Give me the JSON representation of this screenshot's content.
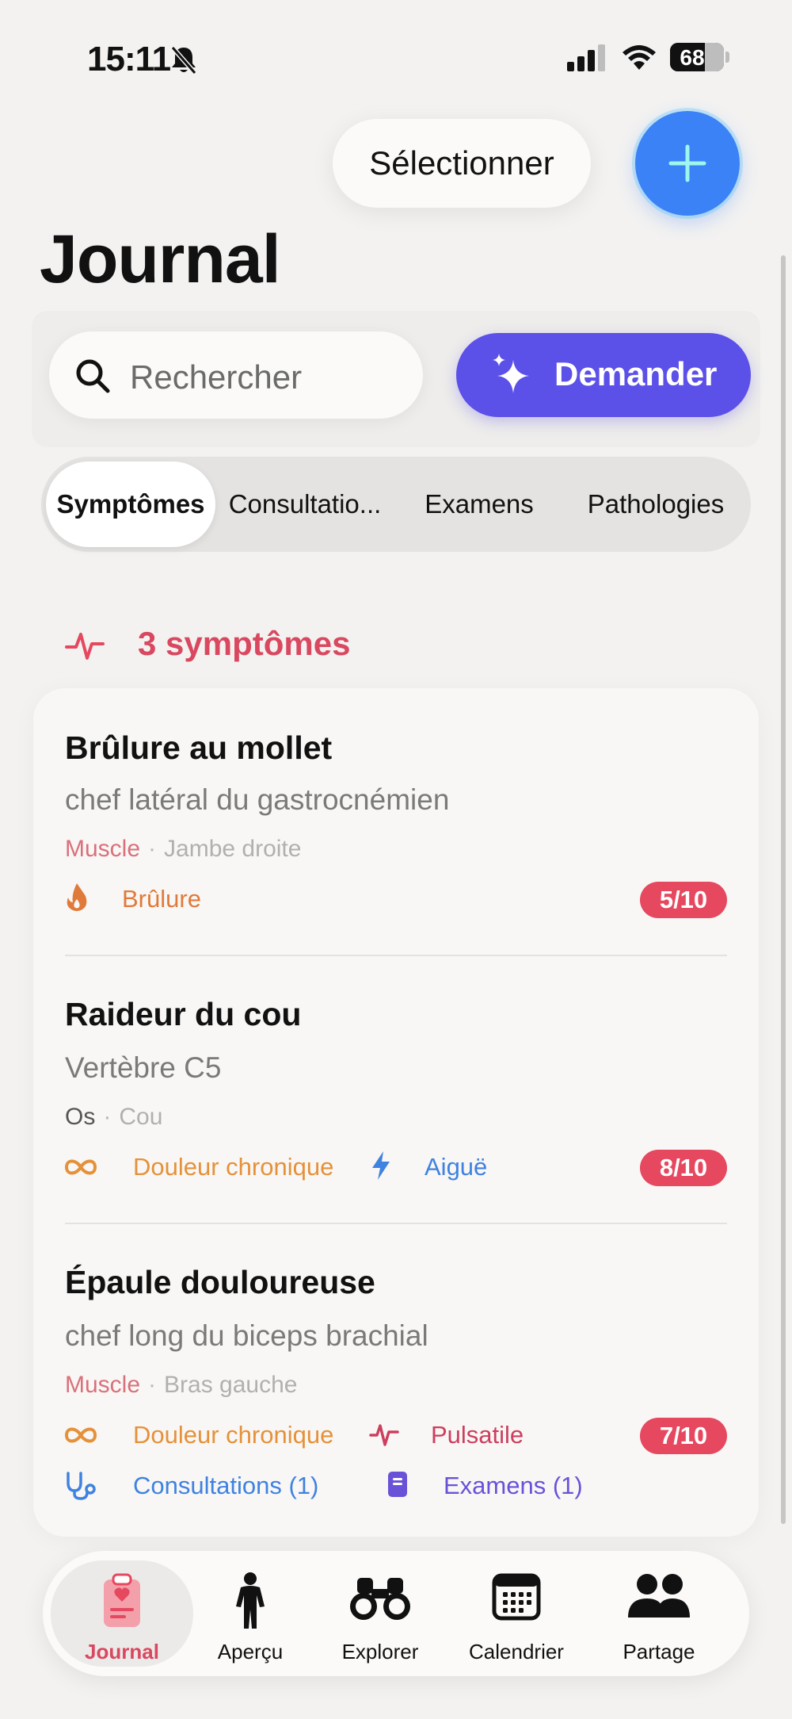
{
  "status_bar": {
    "time": "15:11",
    "battery": "68"
  },
  "header": {
    "select_label": "Sélectionner",
    "title": "Journal"
  },
  "search": {
    "placeholder": "Rechercher",
    "ask_label": "Demander"
  },
  "tabs": [
    {
      "label": "Symptômes",
      "active": true
    },
    {
      "label": "Consultatio..."
    },
    {
      "label": "Examens"
    },
    {
      "label": "Pathologies"
    }
  ],
  "section": {
    "title": "3 symptômes"
  },
  "symptoms": [
    {
      "title": "Brûlure au mollet",
      "subtitle": "chef latéral du gastrocnémien",
      "category": "Muscle",
      "location": "Jambe droite",
      "tags": [
        {
          "icon": "flame-icon",
          "label": "Brûlure",
          "color": "#e07a3a"
        }
      ],
      "score": "5/10"
    },
    {
      "title": "Raideur du cou",
      "subtitle": "Vertèbre C5",
      "category": "Os",
      "location": "Cou",
      "tags": [
        {
          "icon": "infinity-icon",
          "label": "Douleur chronique",
          "color": "#e5913a"
        },
        {
          "icon": "lightning-icon",
          "label": "Aiguë",
          "color": "#3f82e0"
        }
      ],
      "score": "8/10"
    },
    {
      "title": "Épaule douloureuse",
      "subtitle": "chef long du biceps brachial",
      "category": "Muscle",
      "location": "Bras gauche",
      "tags": [
        {
          "icon": "infinity-icon",
          "label": "Douleur chronique",
          "color": "#e5913a"
        },
        {
          "icon": "pulse-icon",
          "label": "Pulsatile",
          "color": "#cc3f5e"
        }
      ],
      "links": [
        {
          "icon": "stethoscope-icon",
          "label": "Consultations (1)",
          "color": "#3f82e0"
        },
        {
          "icon": "document-icon",
          "label": "Examens (1)",
          "color": "#6a52d8"
        }
      ],
      "score": "7/10"
    }
  ],
  "tab_bar": [
    {
      "label": "Journal",
      "icon": "clipboard-heart-icon",
      "active": true
    },
    {
      "label": "Aperçu",
      "icon": "person-icon"
    },
    {
      "label": "Explorer",
      "icon": "binoculars-icon"
    },
    {
      "label": "Calendrier",
      "icon": "calendar-icon"
    },
    {
      "label": "Partage",
      "icon": "people-icon"
    }
  ],
  "colors": {
    "accent_red": "#e5485f",
    "primary_blue": "#3b82f6",
    "ask_purple": "#5b50e8"
  }
}
